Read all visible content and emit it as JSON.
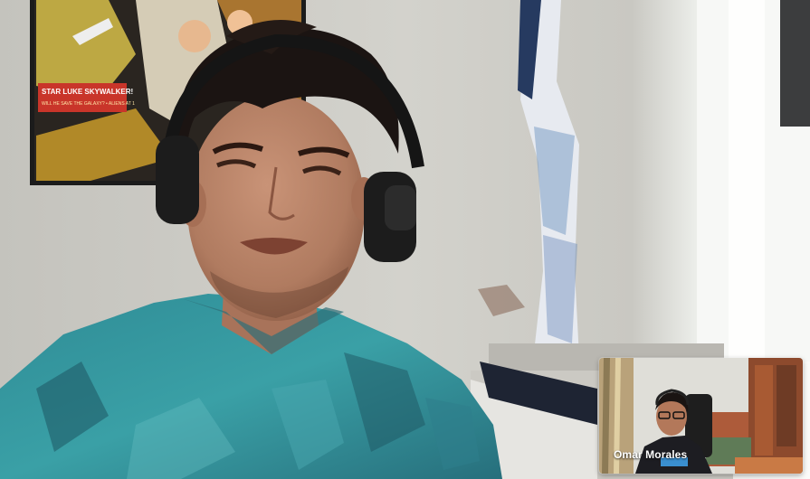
{
  "call": {
    "self_view": {
      "participant_name": "Omar Morales"
    },
    "main_video": {
      "poster": {
        "banner_line1": "STAR LUKE SKYWALKER!",
        "banner_line2": "WILL HE SAVE THE GALAXY? • ALIENS AT 1"
      }
    }
  }
}
